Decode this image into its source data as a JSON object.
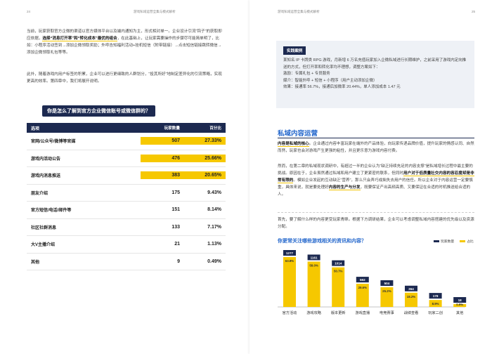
{
  "left_page": {
    "page_number": "24",
    "header_title": "游戏私域运营全集与模式解析",
    "paragraph1_a": "当前，玩家获取官方企微的渠道以官方媒体平台以及端内通知为主，形式相对单一。企业设计引流“钩子”的获取即应依据，",
    "paragraph1_highlight": "选择“消息打开率”和“转化成本”最优的组合",
    "paragraph1_b": "，在此基础上，让玩家需要操作的步骤尽可能简单明了，比如：小程序活动签到→添加企微领取奖励；外呼告知福利活动+挂机短信（附带链接）→点击短信链接跳转微信→添加企微领取礼包等等。",
    "paragraph2": "此外，随着游戏内用户标签的积累，企业可以进行更细致的人群划分，“投其所好”地制定差异化的引流策略，实现更高的效率。第四章中，我们将展开说明。",
    "question_title": "你是怎么了解到官方企业微信账号或微信群的？",
    "table": {
      "headers": [
        "选项",
        "玩家数量",
        "百分比"
      ],
      "rows": [
        {
          "label": "官网/公众号/微博等官媒",
          "count": "507",
          "pct": "27.33%",
          "highlight": true
        },
        {
          "label": "游戏内活动公告",
          "count": "476",
          "pct": "25.66%",
          "highlight": true
        },
        {
          "label": "游戏内消息推送",
          "count": "383",
          "pct": "20.65%",
          "highlight": true
        },
        {
          "label": "朋友介绍",
          "count": "175",
          "pct": "9.43%",
          "highlight": false
        },
        {
          "label": "官方短信/电话/邮件等",
          "count": "151",
          "pct": "8.14%",
          "highlight": false
        },
        {
          "label": "社区社群消息",
          "count": "133",
          "pct": "7.17%",
          "highlight": false
        },
        {
          "label": "大V主播介绍",
          "count": "21",
          "pct": "1.13%",
          "highlight": false
        },
        {
          "label": "其他",
          "count": "9",
          "pct": "0.49%",
          "highlight": false
        }
      ]
    }
  },
  "right_page": {
    "page_number": "25",
    "header_title": "游戏私域运营全集与模式解析",
    "case_tag": "实践案例",
    "case_intro": "某知名 IP 卡牌类 RPG 游戏，月新增 6 万名充值玩家加入企微私域进行长期维护，之前采用了游戏内定向推送的方式，但打开率和转化率均不理想，调整方案如下：",
    "case_lines": [
      "激励：专属礼包 + 专员服务",
      "媒介：智能外呼 + 短信 + 小程序（用户主动添加企微）",
      "效果：接通率 56.7%，接通后加微率 20.44%，单人添加成本 1.47 元"
    ],
    "section_title": "私域内容运营",
    "section_para1_highlight": "内容是私域的核心",
    "section_para1": "。企业通过内容丰富玩家在端外的产品体验，向玩家传递品牌价值，提升玩家的情感认同、自然而然，玩家也会对游戏产生更强的粘性，并且更乐意为游戏内容付费。",
    "section_para2_a": "然而，在第二章的私域现状调研中，有超过一半的企业认为“缺乏持续充足的内容支撑”是私域增长过程中最主要的挑战。原因在于，企业虽然通过私域和用户建立了更紧密的联系，但同时",
    "section_para2_highlight": "用户对于低质量社交内容的容忍度却是非常有限的",
    "section_para2_b": "。模如企业发起的互动缺乏“营养”，那么只会弄巧成拙失去用户的信任。所以企业对于内容运营一定要慎重，具体来说，就是要处理好",
    "section_para2_highlight2": "内容的生产与分发",
    "section_para2_c": "，既要保证产出高频高质、又要保证在合适的时机推送给合适的人。",
    "section_para3": "首先，要了解什么样的内容更受玩家青睐。根据下方调研结果，企业可以考虑调整私域内容搭建的优先级以及资源分配。",
    "chart_question": "你更常关注哪些游戏相关的资讯和内容？",
    "legend_count": "玩家数量",
    "legend_pct": "占比"
  },
  "colors": {
    "navy": "#1c2950",
    "gold": "#f6c800",
    "blue": "#2266cc"
  },
  "chart_data": {
    "type": "bar",
    "title": "你更常关注哪些游戏相关的资讯和内容？",
    "categories": [
      "官方活动",
      "游戏攻略",
      "版本更新",
      "游戏直播",
      "电竞赛事",
      "战绩查看",
      "玩家二创",
      "其他"
    ],
    "series": [
      {
        "name": "玩家数量",
        "values": [
          1277,
          1161,
          1014,
          592,
          504,
          364,
          178,
          18
        ]
      },
      {
        "name": "占比",
        "values": [
          63.8,
          58.0,
          50.7,
          29.6,
          25.2,
          18.2,
          8.9,
          0.9
        ]
      }
    ],
    "pct_labels": [
      "63.8%",
      "58.0%",
      "50.7%",
      "29.6%",
      "25.2%",
      "18.2%",
      "8.9%",
      "0.9%"
    ],
    "ylim": [
      0,
      1400
    ],
    "legend_position": "top-right",
    "grid": false
  }
}
